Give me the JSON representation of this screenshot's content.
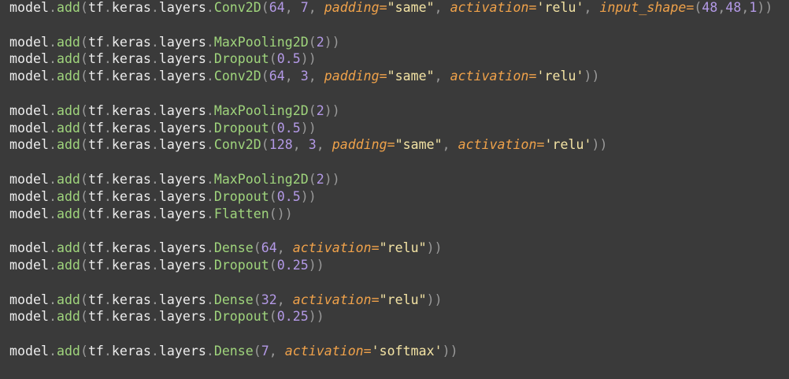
{
  "colors": {
    "background": "#3a3a3a",
    "plain": "#ececec",
    "punctuation": "#9a9a9a",
    "function": "#9fd47c",
    "number": "#b399e6",
    "keyword_arg": "#f0a24a",
    "string": "#f3e3a4"
  },
  "code": {
    "lines": [
      [
        [
          "plain",
          "model"
        ],
        [
          "dot",
          "."
        ],
        [
          "fn",
          "add"
        ],
        [
          "punc",
          "("
        ],
        [
          "plain",
          "tf"
        ],
        [
          "dot",
          "."
        ],
        [
          "plain",
          "keras"
        ],
        [
          "dot",
          "."
        ],
        [
          "plain",
          "layers"
        ],
        [
          "dot",
          "."
        ],
        [
          "fn",
          "Conv2D"
        ],
        [
          "punc",
          "("
        ],
        [
          "num",
          "64"
        ],
        [
          "punc",
          ", "
        ],
        [
          "num",
          "7"
        ],
        [
          "punc",
          ", "
        ],
        [
          "kw",
          "padding"
        ],
        [
          "op",
          "="
        ],
        [
          "str",
          "\"same\""
        ],
        [
          "punc",
          ", "
        ],
        [
          "kw",
          "activation"
        ],
        [
          "op",
          "="
        ],
        [
          "str",
          "'relu'"
        ],
        [
          "punc",
          ", "
        ],
        [
          "kw",
          "input_shape"
        ],
        [
          "op",
          "="
        ],
        [
          "punc",
          "("
        ],
        [
          "num",
          "48"
        ],
        [
          "punc",
          ","
        ],
        [
          "num",
          "48"
        ],
        [
          "punc",
          ","
        ],
        [
          "num",
          "1"
        ],
        [
          "punc",
          "))"
        ]
      ],
      [],
      [
        [
          "plain",
          "model"
        ],
        [
          "dot",
          "."
        ],
        [
          "fn",
          "add"
        ],
        [
          "punc",
          "("
        ],
        [
          "plain",
          "tf"
        ],
        [
          "dot",
          "."
        ],
        [
          "plain",
          "keras"
        ],
        [
          "dot",
          "."
        ],
        [
          "plain",
          "layers"
        ],
        [
          "dot",
          "."
        ],
        [
          "fn",
          "MaxPooling2D"
        ],
        [
          "punc",
          "("
        ],
        [
          "num",
          "2"
        ],
        [
          "punc",
          "))"
        ]
      ],
      [
        [
          "plain",
          "model"
        ],
        [
          "dot",
          "."
        ],
        [
          "fn",
          "add"
        ],
        [
          "punc",
          "("
        ],
        [
          "plain",
          "tf"
        ],
        [
          "dot",
          "."
        ],
        [
          "plain",
          "keras"
        ],
        [
          "dot",
          "."
        ],
        [
          "plain",
          "layers"
        ],
        [
          "dot",
          "."
        ],
        [
          "fn",
          "Dropout"
        ],
        [
          "punc",
          "("
        ],
        [
          "num",
          "0.5"
        ],
        [
          "punc",
          "))"
        ]
      ],
      [
        [
          "plain",
          "model"
        ],
        [
          "dot",
          "."
        ],
        [
          "fn",
          "add"
        ],
        [
          "punc",
          "("
        ],
        [
          "plain",
          "tf"
        ],
        [
          "dot",
          "."
        ],
        [
          "plain",
          "keras"
        ],
        [
          "dot",
          "."
        ],
        [
          "plain",
          "layers"
        ],
        [
          "dot",
          "."
        ],
        [
          "fn",
          "Conv2D"
        ],
        [
          "punc",
          "("
        ],
        [
          "num",
          "64"
        ],
        [
          "punc",
          ", "
        ],
        [
          "num",
          "3"
        ],
        [
          "punc",
          ", "
        ],
        [
          "kw",
          "padding"
        ],
        [
          "op",
          "="
        ],
        [
          "str",
          "\"same\""
        ],
        [
          "punc",
          ", "
        ],
        [
          "kw",
          "activation"
        ],
        [
          "op",
          "="
        ],
        [
          "str",
          "'relu'"
        ],
        [
          "punc",
          "))"
        ]
      ],
      [],
      [
        [
          "plain",
          "model"
        ],
        [
          "dot",
          "."
        ],
        [
          "fn",
          "add"
        ],
        [
          "punc",
          "("
        ],
        [
          "plain",
          "tf"
        ],
        [
          "dot",
          "."
        ],
        [
          "plain",
          "keras"
        ],
        [
          "dot",
          "."
        ],
        [
          "plain",
          "layers"
        ],
        [
          "dot",
          "."
        ],
        [
          "fn",
          "MaxPooling2D"
        ],
        [
          "punc",
          "("
        ],
        [
          "num",
          "2"
        ],
        [
          "punc",
          "))"
        ]
      ],
      [
        [
          "plain",
          "model"
        ],
        [
          "dot",
          "."
        ],
        [
          "fn",
          "add"
        ],
        [
          "punc",
          "("
        ],
        [
          "plain",
          "tf"
        ],
        [
          "dot",
          "."
        ],
        [
          "plain",
          "keras"
        ],
        [
          "dot",
          "."
        ],
        [
          "plain",
          "layers"
        ],
        [
          "dot",
          "."
        ],
        [
          "fn",
          "Dropout"
        ],
        [
          "punc",
          "("
        ],
        [
          "num",
          "0.5"
        ],
        [
          "punc",
          "))"
        ]
      ],
      [
        [
          "plain",
          "model"
        ],
        [
          "dot",
          "."
        ],
        [
          "fn",
          "add"
        ],
        [
          "punc",
          "("
        ],
        [
          "plain",
          "tf"
        ],
        [
          "dot",
          "."
        ],
        [
          "plain",
          "keras"
        ],
        [
          "dot",
          "."
        ],
        [
          "plain",
          "layers"
        ],
        [
          "dot",
          "."
        ],
        [
          "fn",
          "Conv2D"
        ],
        [
          "punc",
          "("
        ],
        [
          "num",
          "128"
        ],
        [
          "punc",
          ", "
        ],
        [
          "num",
          "3"
        ],
        [
          "punc",
          ", "
        ],
        [
          "kw",
          "padding"
        ],
        [
          "op",
          "="
        ],
        [
          "str",
          "\"same\""
        ],
        [
          "punc",
          ", "
        ],
        [
          "kw",
          "activation"
        ],
        [
          "op",
          "="
        ],
        [
          "str",
          "'relu'"
        ],
        [
          "punc",
          "))"
        ]
      ],
      [],
      [
        [
          "plain",
          "model"
        ],
        [
          "dot",
          "."
        ],
        [
          "fn",
          "add"
        ],
        [
          "punc",
          "("
        ],
        [
          "plain",
          "tf"
        ],
        [
          "dot",
          "."
        ],
        [
          "plain",
          "keras"
        ],
        [
          "dot",
          "."
        ],
        [
          "plain",
          "layers"
        ],
        [
          "dot",
          "."
        ],
        [
          "fn",
          "MaxPooling2D"
        ],
        [
          "punc",
          "("
        ],
        [
          "num",
          "2"
        ],
        [
          "punc",
          "))"
        ]
      ],
      [
        [
          "plain",
          "model"
        ],
        [
          "dot",
          "."
        ],
        [
          "fn",
          "add"
        ],
        [
          "punc",
          "("
        ],
        [
          "plain",
          "tf"
        ],
        [
          "dot",
          "."
        ],
        [
          "plain",
          "keras"
        ],
        [
          "dot",
          "."
        ],
        [
          "plain",
          "layers"
        ],
        [
          "dot",
          "."
        ],
        [
          "fn",
          "Dropout"
        ],
        [
          "punc",
          "("
        ],
        [
          "num",
          "0.5"
        ],
        [
          "punc",
          "))"
        ]
      ],
      [
        [
          "plain",
          "model"
        ],
        [
          "dot",
          "."
        ],
        [
          "fn",
          "add"
        ],
        [
          "punc",
          "("
        ],
        [
          "plain",
          "tf"
        ],
        [
          "dot",
          "."
        ],
        [
          "plain",
          "keras"
        ],
        [
          "dot",
          "."
        ],
        [
          "plain",
          "layers"
        ],
        [
          "dot",
          "."
        ],
        [
          "fn",
          "Flatten"
        ],
        [
          "punc",
          "())"
        ]
      ],
      [],
      [
        [
          "plain",
          "model"
        ],
        [
          "dot",
          "."
        ],
        [
          "fn",
          "add"
        ],
        [
          "punc",
          "("
        ],
        [
          "plain",
          "tf"
        ],
        [
          "dot",
          "."
        ],
        [
          "plain",
          "keras"
        ],
        [
          "dot",
          "."
        ],
        [
          "plain",
          "layers"
        ],
        [
          "dot",
          "."
        ],
        [
          "fn",
          "Dense"
        ],
        [
          "punc",
          "("
        ],
        [
          "num",
          "64"
        ],
        [
          "punc",
          ", "
        ],
        [
          "kw",
          "activation"
        ],
        [
          "op",
          "="
        ],
        [
          "str",
          "\"relu\""
        ],
        [
          "punc",
          "))"
        ]
      ],
      [
        [
          "plain",
          "model"
        ],
        [
          "dot",
          "."
        ],
        [
          "fn",
          "add"
        ],
        [
          "punc",
          "("
        ],
        [
          "plain",
          "tf"
        ],
        [
          "dot",
          "."
        ],
        [
          "plain",
          "keras"
        ],
        [
          "dot",
          "."
        ],
        [
          "plain",
          "layers"
        ],
        [
          "dot",
          "."
        ],
        [
          "fn",
          "Dropout"
        ],
        [
          "punc",
          "("
        ],
        [
          "num",
          "0.25"
        ],
        [
          "punc",
          "))"
        ]
      ],
      [],
      [
        [
          "plain",
          "model"
        ],
        [
          "dot",
          "."
        ],
        [
          "fn",
          "add"
        ],
        [
          "punc",
          "("
        ],
        [
          "plain",
          "tf"
        ],
        [
          "dot",
          "."
        ],
        [
          "plain",
          "keras"
        ],
        [
          "dot",
          "."
        ],
        [
          "plain",
          "layers"
        ],
        [
          "dot",
          "."
        ],
        [
          "fn",
          "Dense"
        ],
        [
          "punc",
          "("
        ],
        [
          "num",
          "32"
        ],
        [
          "punc",
          ", "
        ],
        [
          "kw",
          "activation"
        ],
        [
          "op",
          "="
        ],
        [
          "str",
          "\"relu\""
        ],
        [
          "punc",
          "))"
        ]
      ],
      [
        [
          "plain",
          "model"
        ],
        [
          "dot",
          "."
        ],
        [
          "fn",
          "add"
        ],
        [
          "punc",
          "("
        ],
        [
          "plain",
          "tf"
        ],
        [
          "dot",
          "."
        ],
        [
          "plain",
          "keras"
        ],
        [
          "dot",
          "."
        ],
        [
          "plain",
          "layers"
        ],
        [
          "dot",
          "."
        ],
        [
          "fn",
          "Dropout"
        ],
        [
          "punc",
          "("
        ],
        [
          "num",
          "0.25"
        ],
        [
          "punc",
          "))"
        ]
      ],
      [],
      [
        [
          "plain",
          "model"
        ],
        [
          "dot",
          "."
        ],
        [
          "fn",
          "add"
        ],
        [
          "punc",
          "("
        ],
        [
          "plain",
          "tf"
        ],
        [
          "dot",
          "."
        ],
        [
          "plain",
          "keras"
        ],
        [
          "dot",
          "."
        ],
        [
          "plain",
          "layers"
        ],
        [
          "dot",
          "."
        ],
        [
          "fn",
          "Dense"
        ],
        [
          "punc",
          "("
        ],
        [
          "num",
          "7"
        ],
        [
          "punc",
          ", "
        ],
        [
          "kw",
          "activation"
        ],
        [
          "op",
          "="
        ],
        [
          "str",
          "'softmax'"
        ],
        [
          "punc",
          "))"
        ]
      ]
    ]
  }
}
